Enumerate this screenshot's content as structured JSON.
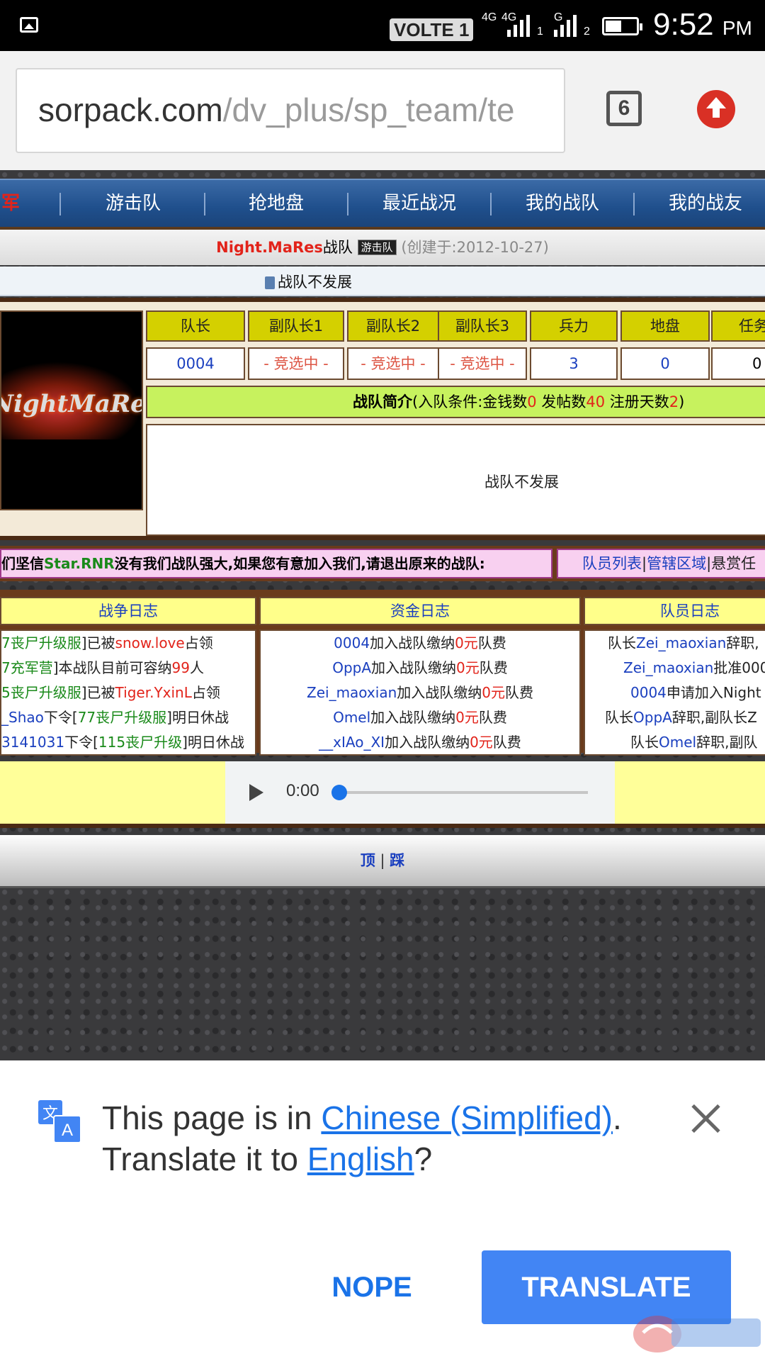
{
  "status_bar": {
    "volte": "VOLTE 1",
    "sim1_network": "4G",
    "sim1_network2": "4G",
    "sim1_index": "1",
    "sim2_network": "G",
    "sim2_index": "2",
    "time": "9:52",
    "ampm": "PM"
  },
  "browser": {
    "url_host": "sorpack.com",
    "url_path": "/dv_plus/sp_team/te",
    "tab_count": "6"
  },
  "page": {
    "nav": [
      "军",
      "游击队",
      "抢地盘",
      "最近战况",
      "我的战队",
      "我的战友"
    ],
    "team_name": "Night.MaRes",
    "team_suffix": "战队",
    "team_badge": "游击队",
    "created": "(创建于:2012-10-27)",
    "announcement": "战队不发展",
    "logo_text": "NightMaRes",
    "stats": {
      "headers": [
        "队长",
        "副队长1",
        "副队长2",
        "副队长3",
        "兵力",
        "地盘",
        "任务"
      ],
      "values": [
        "0004",
        "- 竞选中 -",
        "- 竞选中 -",
        "- 竞选中 -",
        "3",
        "0",
        "0"
      ]
    },
    "intro": {
      "label": "战队简介",
      "cond_prefix": "(入队条件:金钱数",
      "money": "0",
      "posts_label": " 发帖数",
      "posts": "40",
      "days_label": " 注册天数",
      "days": "2",
      "close": ")",
      "body": "战队不发展"
    },
    "slogan": {
      "prefix": "们坚信",
      "site": "Star.RNR",
      "rest": "没有我们战队强大,如果您有意加入我们,请退出原来的战队:"
    },
    "sublinks": [
      "队员列表",
      "管辖区域",
      "悬赏任"
    ],
    "logs": {
      "headers": [
        "战争日志",
        "资金日志",
        "队员日志"
      ],
      "war": [
        {
          "a": "7丧尸升级服",
          "b": "]已被",
          "c": "snow.love",
          "d": "占领"
        },
        {
          "a": "7充军营",
          "b": "]本战队目前可容纳",
          "c": "99",
          "d": "人"
        },
        {
          "a": "5丧尸升级服",
          "b": "]已被",
          "c": "Tiger.YxinL",
          "d": "占领"
        },
        {
          "a": "_Shao",
          "b": "下令[",
          "c": "77丧尸升级服",
          "d": "]明日休战"
        },
        {
          "a": "3141031",
          "b": "下令[",
          "c": "115丧尸升级",
          "d": "]明日休战"
        }
      ],
      "fund": [
        {
          "user": "0004",
          "text": "加入战队缴纳",
          "amount": "0元",
          "tail": "队费"
        },
        {
          "user": "OppA",
          "text": "加入战队缴纳",
          "amount": "0元",
          "tail": "队费"
        },
        {
          "user": "Zei_maoxian",
          "text": "加入战队缴纳",
          "amount": "0元",
          "tail": "队费"
        },
        {
          "user": "Omel",
          "text": "加入战队缴纳",
          "amount": "0元",
          "tail": "队费"
        },
        {
          "user": "__xIAo_XI",
          "text": "加入战队缴纳",
          "amount": "0元",
          "tail": "队费"
        }
      ],
      "member": [
        {
          "pre": "队长",
          "user": "Zei_maoxian",
          "text": "辞职,"
        },
        {
          "pre": "",
          "user": "Zei_maoxian",
          "text": "批准000"
        },
        {
          "pre": "",
          "user": "0004",
          "text": "申请加入Night"
        },
        {
          "pre": "队长",
          "user": "OppA",
          "text": "辞职,副队长Z"
        },
        {
          "pre": "队长",
          "user": "Omel",
          "text": "辞职,副队"
        }
      ]
    },
    "audio": {
      "time": "0:00",
      "progress": 0
    },
    "footer": {
      "top": "顶",
      "sep": " | ",
      "down": "踩"
    }
  },
  "translate_bar": {
    "line1_prefix": "This page is in ",
    "source_lang": "Chinese (Simplified)",
    "line1_suffix": ".",
    "line2_prefix": "Translate it to ",
    "target_lang": "English",
    "line2_suffix": "?",
    "nope": "NOPE",
    "translate": "TRANSLATE"
  },
  "colors": {
    "translate_button": "#4285f4",
    "link_blue": "#1a73e8",
    "nav_band": "#1f4f8c",
    "accent_red": "#e2231a"
  }
}
